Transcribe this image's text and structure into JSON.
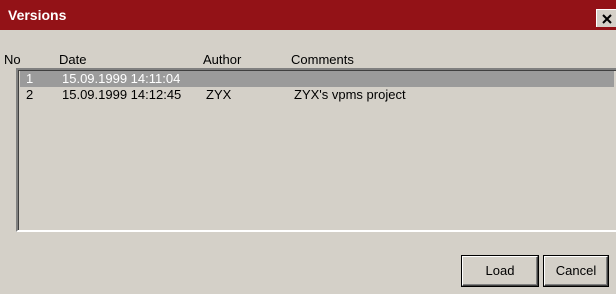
{
  "window": {
    "title": "Versions",
    "close_icon": "close-icon",
    "title_bar_color": "#931217"
  },
  "columns": [
    "No",
    "Date",
    "Author",
    "Comments"
  ],
  "versions": [
    {
      "no": "1",
      "date": "15.09.1999 14:11:04",
      "author": "",
      "comments": "",
      "selected": true
    },
    {
      "no": "2",
      "date": "15.09.1999 14:12:45",
      "author": "ZYX",
      "comments": "ZYX's vpms project",
      "selected": false
    }
  ],
  "buttons": {
    "load_label": "Load",
    "cancel_label": "Cancel"
  },
  "colors": {
    "selection": "#9b9b9b",
    "face": "#d4d0c8"
  }
}
